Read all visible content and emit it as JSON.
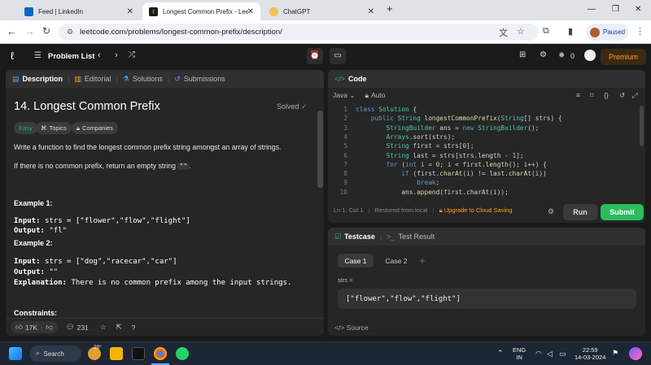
{
  "browser": {
    "tabs": [
      {
        "title": "Feed | LinkedIn",
        "active": false
      },
      {
        "title": "Longest Common Prefix - Leetc",
        "active": true
      },
      {
        "title": "ChatGPT",
        "active": false
      }
    ],
    "url": "leetcode.com/problems/longest-common-prefix/description/",
    "profile_label": "Paused"
  },
  "lc_nav": {
    "problem_list": "Problem List",
    "streak": "0",
    "premium": "Premium"
  },
  "desc_panel": {
    "tabs": [
      "Description",
      "Editorial",
      "Solutions",
      "Submissions"
    ],
    "title": "14. Longest Common Prefix",
    "solved": "Solved",
    "chips": [
      "Easy",
      "Topics",
      "Companies"
    ],
    "p1": "Write a function to find the longest common prefix string amongst an array of strings.",
    "p2a": "If there is no common prefix, return an empty string",
    "p2code": "\"\"",
    "p2b": ".",
    "ex1_head": "Example 1:",
    "ex1_input_label": "Input:",
    "ex1_input": "strs = [\"flower\",\"flow\",\"flight\"]",
    "ex1_output_label": "Output:",
    "ex1_output": "\"fl\"",
    "ex2_head": "Example 2:",
    "ex2_input_label": "Input:",
    "ex2_input": "strs = [\"dog\",\"racecar\",\"car\"]",
    "ex2_output_label": "Output:",
    "ex2_output": "\"\"",
    "ex2_expl_label": "Explanation:",
    "ex2_expl": "There is no common prefix among the input strings.",
    "constraints_head": "Constraints:",
    "likes": "17K",
    "comments": "231"
  },
  "code_panel": {
    "title": "Code",
    "language": "Java",
    "mode": "Auto",
    "lines": [
      {
        "n": "1",
        "text": "class Solution {"
      },
      {
        "n": "2",
        "text": "    public String longestCommonPrefix(String[] strs) {"
      },
      {
        "n": "3",
        "text": "        StringBuilder ans = new StringBuilder();"
      },
      {
        "n": "4",
        "text": "        Arrays.sort(strs);"
      },
      {
        "n": "5",
        "text": "        String first = strs[0];"
      },
      {
        "n": "6",
        "text": "        String last = strs[strs.length - 1];"
      },
      {
        "n": "7",
        "text": "        for (int i = 0; i < first.length(); i++) {"
      },
      {
        "n": "8",
        "text": "            if (first.charAt(i) != last.charAt(i))"
      },
      {
        "n": "9",
        "text": "                break;"
      },
      {
        "n": "10",
        "text": "            ans.append(first.charAt(i));"
      }
    ],
    "cursor": "Ln 1, Col 1",
    "restored": "Restored from local",
    "upgrade": "Upgrade to Cloud Saving",
    "run": "Run",
    "submit": "Submit"
  },
  "testcase_panel": {
    "tab_testcase": "Testcase",
    "tab_result": "Test Result",
    "cases": [
      "Case 1",
      "Case 2"
    ],
    "param_label": "strs =",
    "param_value": "[\"flower\",\"flow\",\"flight\"]",
    "source": "Source"
  },
  "taskbar": {
    "search": "Search",
    "weather": "20°",
    "lang_top": "ENG",
    "lang_bottom": "IN",
    "time": "22:59",
    "date": "14-03-2024"
  }
}
